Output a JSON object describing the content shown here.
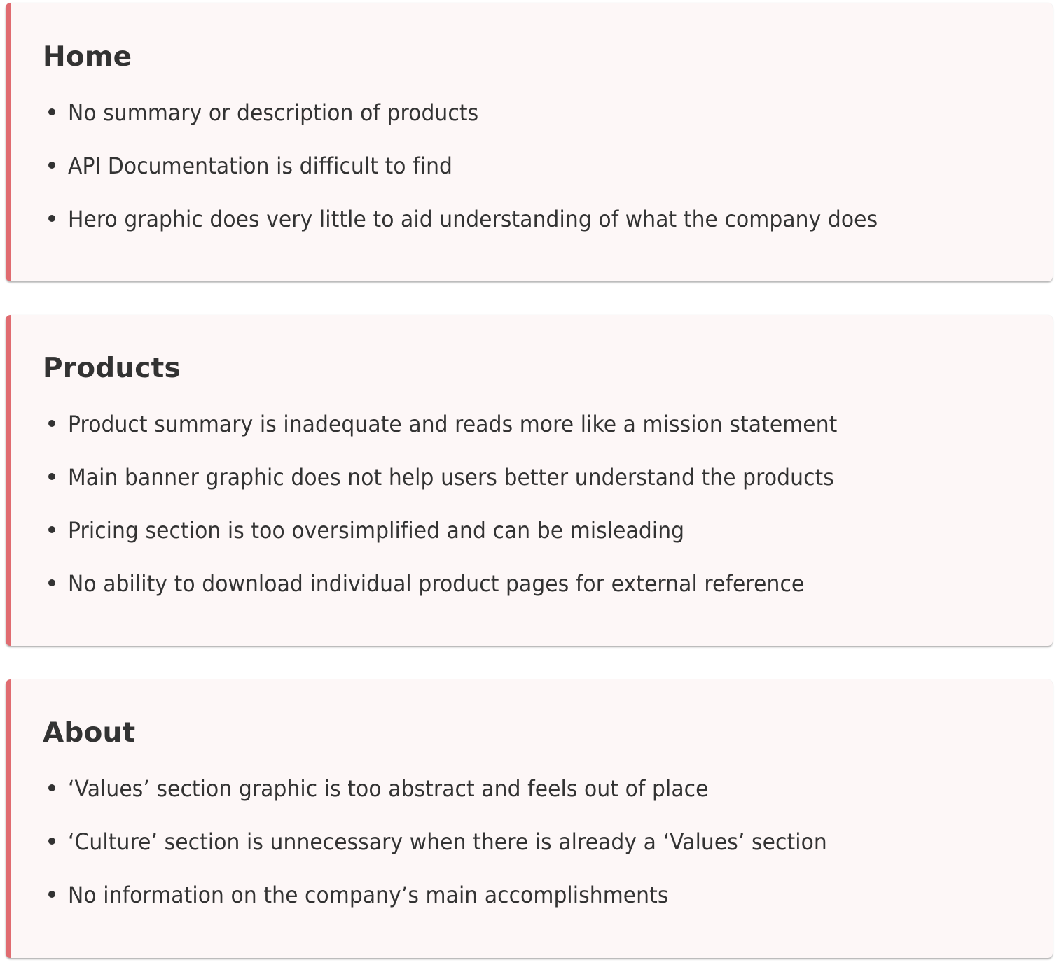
{
  "accent_color": "#e06b70",
  "card_background": "#fdf7f7",
  "text_color": "#333333",
  "sections": [
    {
      "title": "Home",
      "issues": [
        "No summary or description of products",
        "API Documentation is difficult to find",
        "Hero graphic does very little to aid understanding of what the company does"
      ]
    },
    {
      "title": "Products",
      "issues": [
        "Product summary is inadequate and reads more like a mission statement",
        "Main banner graphic does not help users better understand the products",
        "Pricing section is too oversimplified and can be misleading",
        "No ability to download individual product pages for external reference"
      ]
    },
    {
      "title": "About",
      "issues": [
        "‘Values’ section graphic is too abstract and feels out of place",
        "‘Culture’ section is unnecessary when there is already a ‘Values’ section",
        "No information on the company’s main accomplishments"
      ]
    }
  ]
}
